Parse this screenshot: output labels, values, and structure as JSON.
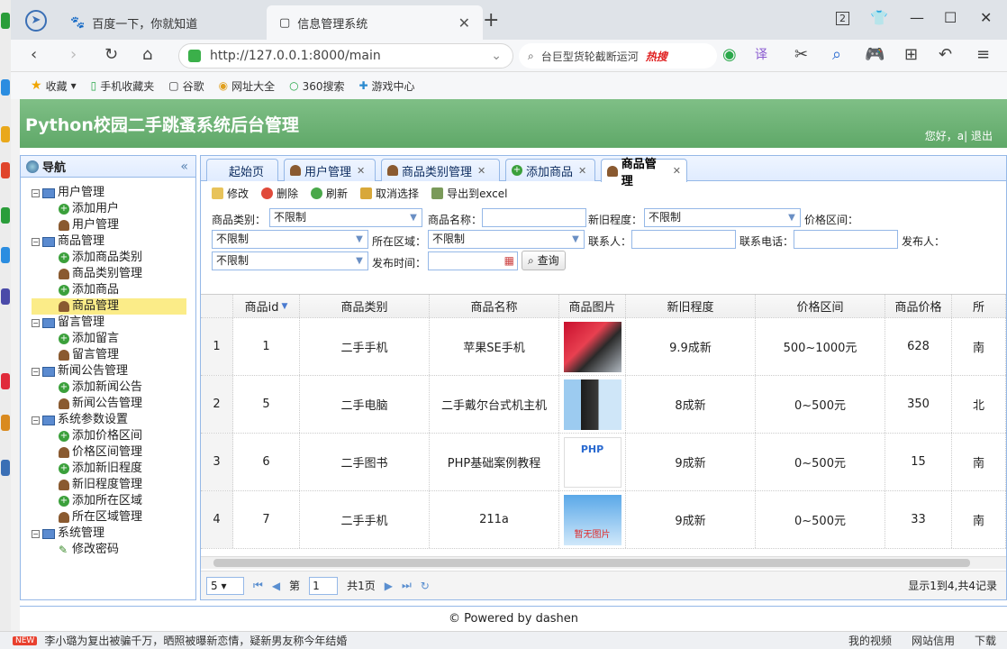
{
  "browser": {
    "tabs": [
      {
        "label": "百度一下，你就知道",
        "active": false
      },
      {
        "label": "信息管理系统",
        "active": true
      }
    ],
    "url": "http://127.0.0.1:8000/main",
    "search_text": "台巨型货轮截断运河",
    "search_hot": "热搜",
    "tab_count": "2",
    "bookmarks": [
      "收藏",
      "手机收藏夹",
      "谷歌",
      "网址大全",
      "360搜索",
      "游戏中心"
    ]
  },
  "header": {
    "title": "Python校园二手跳蚤系统后台管理",
    "user_text": "您好，a| 退出"
  },
  "nav": {
    "title": "导航",
    "groups": [
      {
        "label": "用户管理",
        "items": [
          {
            "label": "添加用户",
            "icon": "add"
          },
          {
            "label": "用户管理",
            "icon": "user"
          }
        ]
      },
      {
        "label": "商品管理",
        "items": [
          {
            "label": "添加商品类别",
            "icon": "add"
          },
          {
            "label": "商品类别管理",
            "icon": "user"
          },
          {
            "label": "添加商品",
            "icon": "add"
          },
          {
            "label": "商品管理",
            "icon": "user",
            "selected": true
          }
        ]
      },
      {
        "label": "留言管理",
        "items": [
          {
            "label": "添加留言",
            "icon": "add"
          },
          {
            "label": "留言管理",
            "icon": "user"
          }
        ]
      },
      {
        "label": "新闻公告管理",
        "items": [
          {
            "label": "添加新闻公告",
            "icon": "add"
          },
          {
            "label": "新闻公告管理",
            "icon": "user"
          }
        ]
      },
      {
        "label": "系统参数设置",
        "items": [
          {
            "label": "添加价格区间",
            "icon": "add"
          },
          {
            "label": "价格区间管理",
            "icon": "user"
          },
          {
            "label": "添加新旧程度",
            "icon": "add"
          },
          {
            "label": "新旧程度管理",
            "icon": "user"
          },
          {
            "label": "添加所在区域",
            "icon": "add"
          },
          {
            "label": "所在区域管理",
            "icon": "user"
          }
        ]
      },
      {
        "label": "系统管理",
        "items": [
          {
            "label": "修改密码",
            "icon": "pen"
          }
        ]
      }
    ]
  },
  "tabs": [
    {
      "label": "起始页",
      "closable": false
    },
    {
      "label": "用户管理",
      "closable": true
    },
    {
      "label": "商品类别管理",
      "closable": true
    },
    {
      "label": "添加商品",
      "closable": true
    },
    {
      "label": "商品管理",
      "closable": true,
      "active": true
    }
  ],
  "toolbar": [
    "修改",
    "删除",
    "刷新",
    "取消选择",
    "导出到excel"
  ],
  "filter": {
    "category_label": "商品类别：",
    "category_value": "不限制",
    "name_label": "商品名称：",
    "degree_label": "新旧程度：",
    "degree_value": "不限制",
    "price_label": "价格区间：",
    "price_value": "不限制",
    "area_label": "所在区域：",
    "area_value": "不限制",
    "contact_label": "联系人：",
    "phone_label": "联系电话：",
    "publisher_label": "发布人：",
    "publisher_value": "不限制",
    "time_label": "发布时间：",
    "query_label": "查询"
  },
  "table": {
    "columns": [
      "商品id",
      "商品类别",
      "商品名称",
      "商品图片",
      "新旧程度",
      "价格区间",
      "商品价格",
      "所"
    ],
    "rows": [
      {
        "no": "1",
        "id": "1",
        "category": "二手手机",
        "name": "苹果SE手机",
        "image": "phone",
        "degree": "9.9成新",
        "price_range": "500~1000元",
        "price": "628",
        "area": "南"
      },
      {
        "no": "2",
        "id": "5",
        "category": "二手电脑",
        "name": "二手戴尔台式机主机",
        "image": "computer",
        "degree": "8成新",
        "price_range": "0~500元",
        "price": "350",
        "area": "北"
      },
      {
        "no": "3",
        "id": "6",
        "category": "二手图书",
        "name": "PHP基础案例教程",
        "image": "book",
        "degree": "9成新",
        "price_range": "0~500元",
        "price": "15",
        "area": "南"
      },
      {
        "no": "4",
        "id": "7",
        "category": "二手手机",
        "name": "211a",
        "image": "noimage",
        "degree": "9成新",
        "price_range": "0~500元",
        "price": "33",
        "area": "南"
      }
    ],
    "noimage_text": "暂无图片",
    "book_text": "PHP"
  },
  "pager": {
    "page_size": "5",
    "page_label": "第",
    "page_value": "1",
    "total_pages": "共1页",
    "info": "显示1到4,共4记录"
  },
  "footer": "© Powered by dashen",
  "statusbar": {
    "news_tag": "NEW",
    "news": "李小璐为复出被骗千万，晒照被曝新恋情，疑新男友称今年结婚",
    "items": [
      "我的视频",
      "网站信用",
      "下载"
    ]
  }
}
